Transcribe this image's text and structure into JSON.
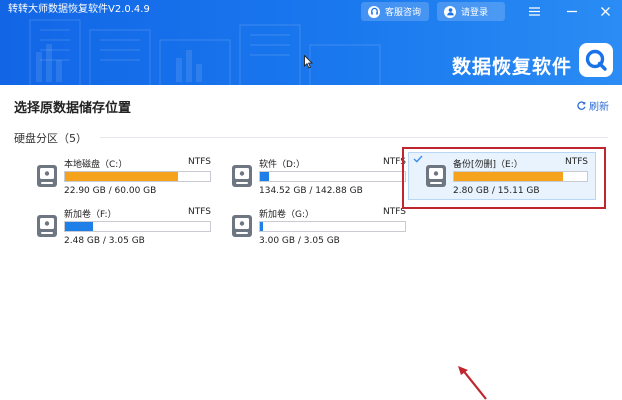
{
  "window": {
    "title": "转转大师数据恢复软件V2.0.4.9",
    "service_label": "客服咨询",
    "login_label": "请登录",
    "brand": "数据恢复软件"
  },
  "main": {
    "title": "选择原数据储存位置",
    "refresh_label": "刷新",
    "section_label": "硬盘分区（5）"
  },
  "drives": [
    {
      "name": "本地磁盘（C:）",
      "fs": "NTFS",
      "size": "22.90 GB / 60.00 GB",
      "used_fraction": 0.78,
      "fill_color": "#f5a31c",
      "selected": false
    },
    {
      "name": "软件（D:）",
      "fs": "NTFS",
      "size": "134.52 GB / 142.88 GB",
      "used_fraction": 0.06,
      "fill_color": "#1f7fe8",
      "selected": false
    },
    {
      "name": "备份[勿删]（E:）",
      "fs": "NTFS",
      "size": "2.80 GB / 15.11 GB",
      "used_fraction": 0.82,
      "fill_color": "#f5a31c",
      "selected": true
    },
    {
      "name": "新加卷（F:）",
      "fs": "NTFS",
      "size": "2.48 GB / 3.05 GB",
      "used_fraction": 0.19,
      "fill_color": "#1f7fe8",
      "selected": false
    },
    {
      "name": "新加卷（G:）",
      "fs": "NTFS",
      "size": "3.00 GB / 3.05 GB",
      "used_fraction": 0.02,
      "fill_color": "#1f7fe8",
      "selected": false
    }
  ],
  "colors": {
    "header_blue": "#1266e6",
    "accent_blue": "#1f7fe8",
    "usage_orange": "#f5a31c",
    "highlight_red": "#c0262d"
  }
}
